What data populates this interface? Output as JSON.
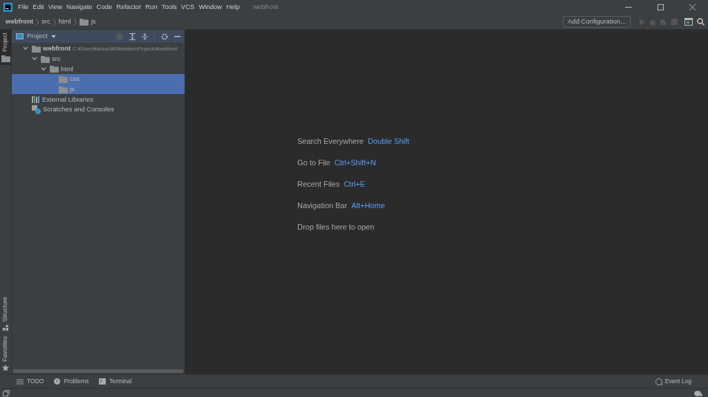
{
  "menu": [
    "File",
    "Edit",
    "View",
    "Navigate",
    "Code",
    "Refactor",
    "Run",
    "Tools",
    "VCS",
    "Window",
    "Help"
  ],
  "window": {
    "title": "webfront"
  },
  "breadcrumbs": [
    {
      "label": "webfront",
      "kind": "root"
    },
    {
      "label": "src",
      "kind": "plain"
    },
    {
      "label": "html",
      "kind": "plain"
    },
    {
      "label": "js",
      "kind": "folder"
    }
  ],
  "toolbar": {
    "config_button": "Add Configuration..."
  },
  "left_strip": [
    {
      "label": "Project",
      "selected": true,
      "kind": "folder"
    },
    {
      "label": "Structure",
      "selected": false,
      "kind": "structure"
    },
    {
      "label": "Favorites",
      "selected": false,
      "kind": "star"
    }
  ],
  "project_panel": {
    "title": "Project",
    "tree": [
      {
        "label": "webfront",
        "path": "C:¥Users¥atsushi¥WebstormProjects¥webfront",
        "kind": "folder",
        "expanded": true,
        "selected": false,
        "children": [
          {
            "label": "src",
            "kind": "folder",
            "expanded": true,
            "selected": false,
            "children": [
              {
                "label": "html",
                "kind": "folder",
                "expanded": true,
                "selected": false,
                "children": [
                  {
                    "label": "css",
                    "kind": "folder",
                    "selected": true
                  },
                  {
                    "label": "js",
                    "kind": "folder",
                    "selected": true
                  }
                ]
              }
            ]
          }
        ]
      },
      {
        "label": "External Libraries",
        "kind": "libraries",
        "selected": false
      },
      {
        "label": "Scratches and Consoles",
        "kind": "scratches",
        "selected": false
      }
    ]
  },
  "editor_hints": [
    {
      "action": "Search Everywhere",
      "shortcut": "Double Shift"
    },
    {
      "action": "Go to File",
      "shortcut": "Ctrl+Shift+N"
    },
    {
      "action": "Recent Files",
      "shortcut": "Ctrl+E"
    },
    {
      "action": "Navigation Bar",
      "shortcut": "Alt+Home"
    },
    {
      "action": "Drop files here to open"
    }
  ],
  "bottom_tabs": [
    {
      "label": "TODO",
      "kind": "list"
    },
    {
      "label": "Problems",
      "kind": "alert"
    },
    {
      "label": "Terminal",
      "kind": "terminal"
    }
  ],
  "event_log": "Event Log"
}
